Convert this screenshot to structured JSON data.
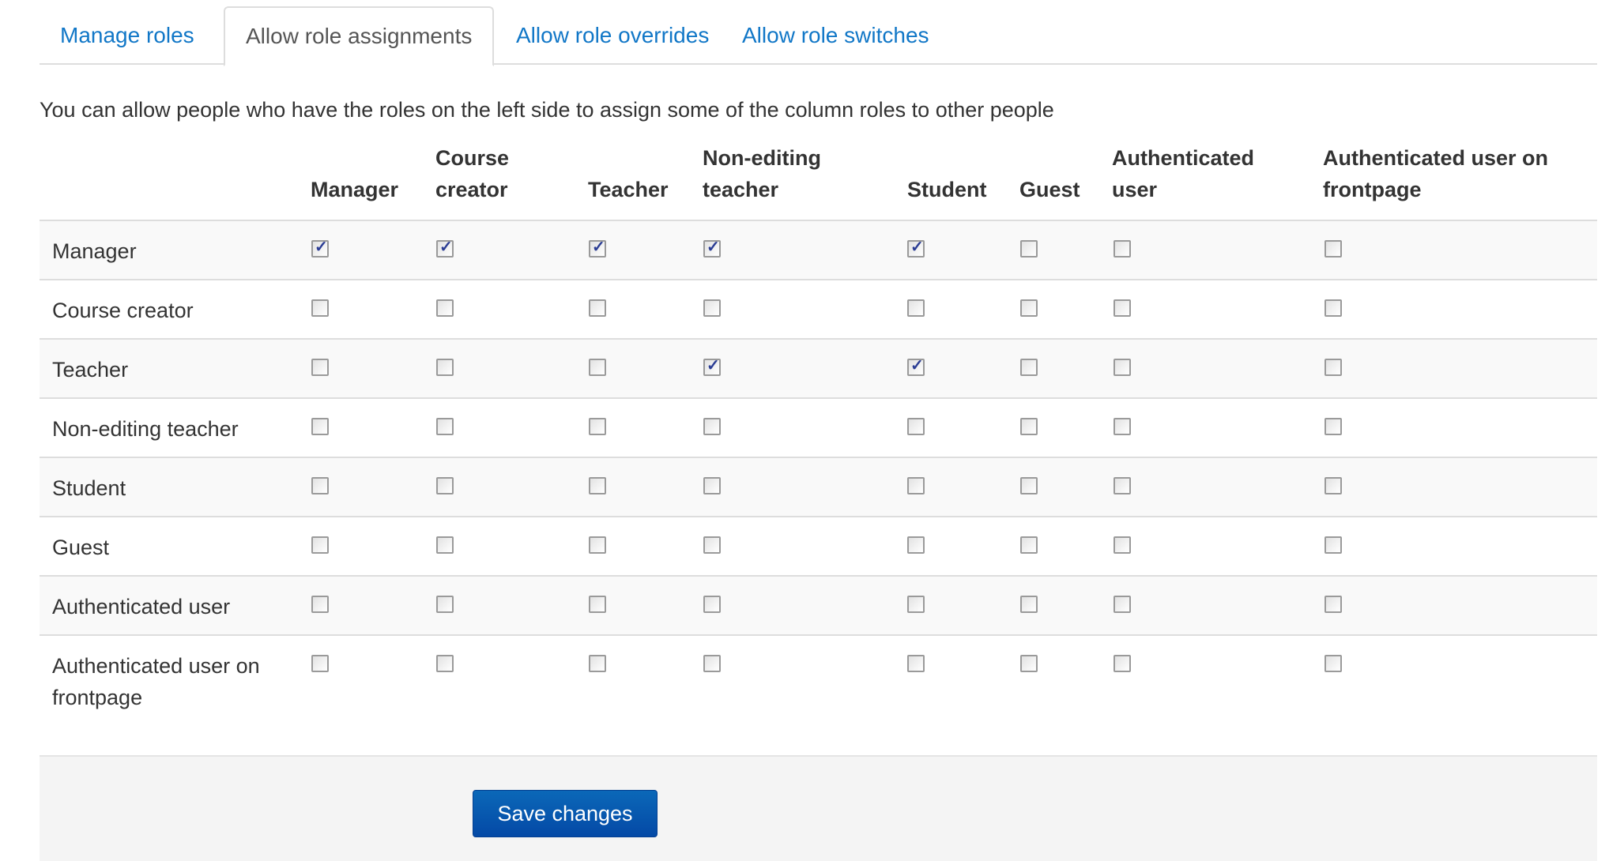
{
  "tabs": [
    {
      "label": "Manage roles",
      "active": false
    },
    {
      "label": "Allow role assignments",
      "active": true
    },
    {
      "label": "Allow role overrides",
      "active": false
    },
    {
      "label": "Allow role switches",
      "active": false
    }
  ],
  "description": "You can allow people who have the roles on the left side to assign some of the column roles to other people",
  "columns": [
    {
      "line1": "",
      "line2": "Manager"
    },
    {
      "line1": "Course",
      "line2": "creator"
    },
    {
      "line1": "",
      "line2": "Teacher"
    },
    {
      "line1": "Non-editing",
      "line2": "teacher"
    },
    {
      "line1": "",
      "line2": "Student"
    },
    {
      "line1": "",
      "line2": "Guest"
    },
    {
      "line1": "Authenticated",
      "line2": "user"
    },
    {
      "line1": "Authenticated user on",
      "line2": "frontpage"
    }
  ],
  "rows": [
    {
      "label": "Manager",
      "checked": [
        true,
        true,
        true,
        true,
        true,
        false,
        false,
        false
      ]
    },
    {
      "label": "Course creator",
      "checked": [
        false,
        false,
        false,
        false,
        false,
        false,
        false,
        false
      ]
    },
    {
      "label": "Teacher",
      "checked": [
        false,
        false,
        false,
        true,
        true,
        false,
        false,
        false
      ]
    },
    {
      "label": "Non-editing teacher",
      "checked": [
        false,
        false,
        false,
        false,
        false,
        false,
        false,
        false
      ]
    },
    {
      "label": "Student",
      "checked": [
        false,
        false,
        false,
        false,
        false,
        false,
        false,
        false
      ]
    },
    {
      "label": "Guest",
      "checked": [
        false,
        false,
        false,
        false,
        false,
        false,
        false,
        false
      ]
    },
    {
      "label": "Authenticated user",
      "checked": [
        false,
        false,
        false,
        false,
        false,
        false,
        false,
        false
      ]
    },
    {
      "label": "Authenticated user on frontpage",
      "checked": [
        false,
        false,
        false,
        false,
        false,
        false,
        false,
        false
      ]
    }
  ],
  "checkmark_glyph": "✓",
  "save_label": "Save changes",
  "colors": {
    "link": "#1177c7",
    "button": "#0b5cb5",
    "check": "#2b3d94"
  }
}
